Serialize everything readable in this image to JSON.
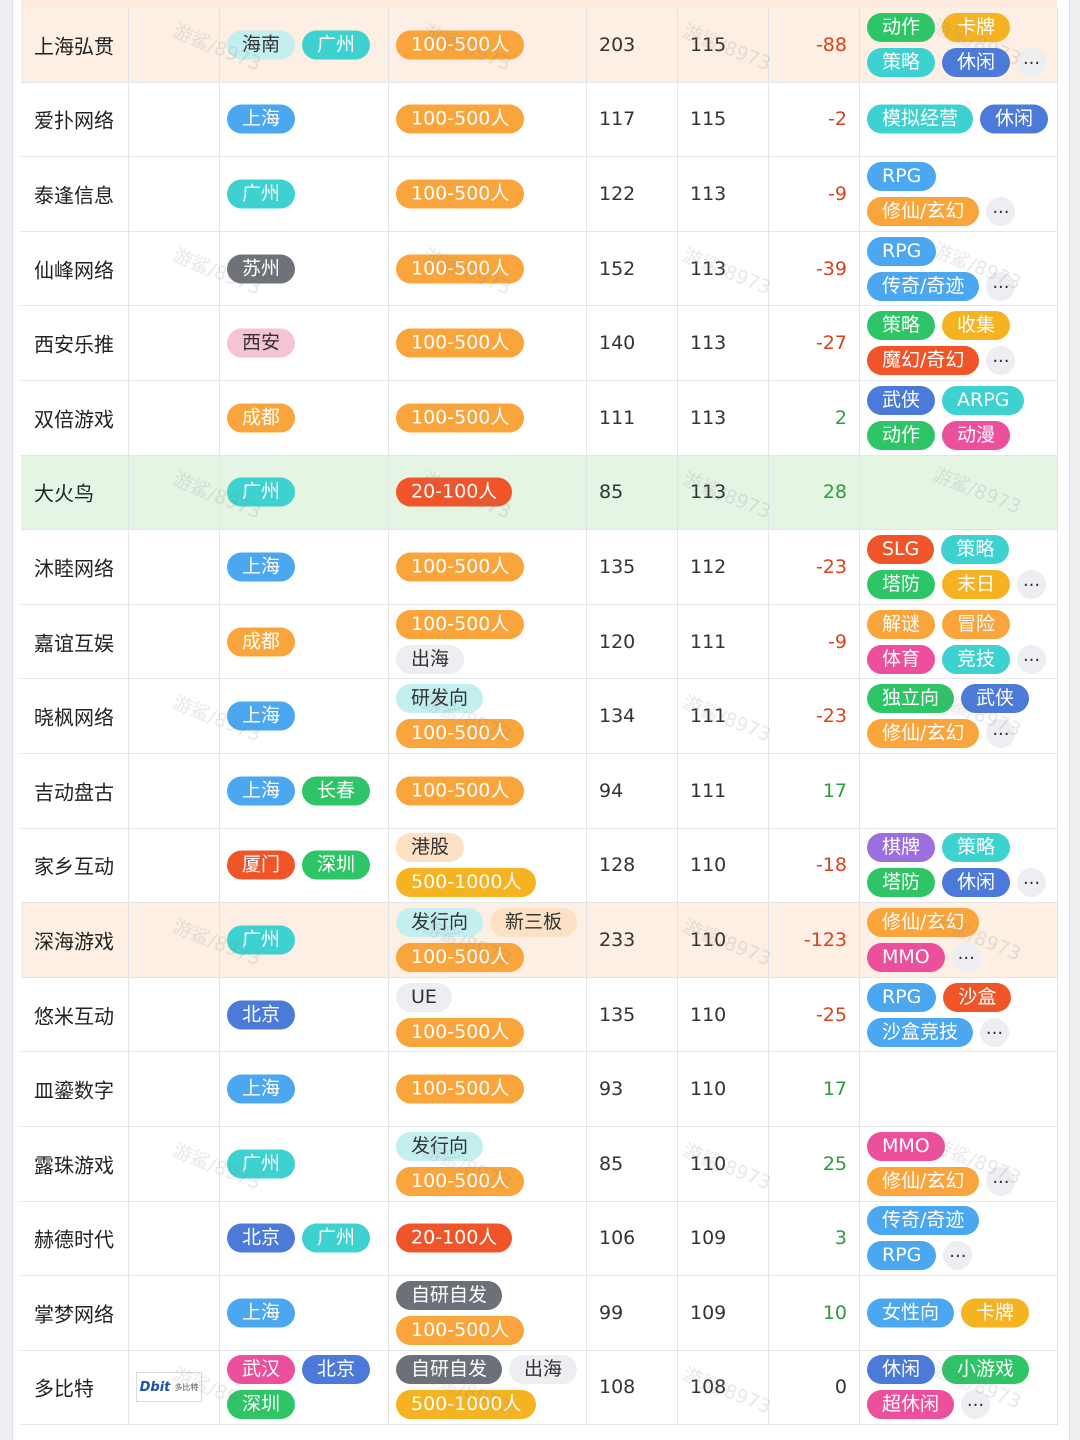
{
  "palette": {
    "cyan": "#3dd2cf",
    "lightcyan": "#c4eff0",
    "blue": "#4aa7f0",
    "gray": "#6e737a",
    "pink": "#f6c3d2",
    "orange": "#f9a53b",
    "red": "#f0552a",
    "green": "#2ec566",
    "peach": "#fde1c4",
    "lightgray": "#eceef1",
    "purple": "#9b6fdd",
    "steel": "#4b7ad8",
    "yellow": "#f6b321",
    "magenta": "#ec4f9b",
    "darkgray": "#6b7079"
  },
  "watermark": "游鲨/8973",
  "more_label": "...",
  "rows": [
    {
      "name": "上海弘贯",
      "style": "orange",
      "logo": null,
      "city": [
        [
          [
            "海南",
            "lightcyan"
          ],
          [
            "广州",
            "cyan"
          ]
        ]
      ],
      "tags": [
        [
          [
            "100-500人",
            "orange"
          ]
        ]
      ],
      "a": "203",
      "b": "115",
      "d": "-88",
      "dtype": "neg",
      "games": [
        [
          [
            "动作",
            "green"
          ],
          [
            "卡牌",
            "yellow"
          ]
        ],
        [
          [
            "策略",
            "cyan"
          ],
          [
            "休闲",
            "steel"
          ],
          [
            "...",
            "more"
          ]
        ]
      ]
    },
    {
      "name": "爱扑网络",
      "style": "",
      "logo": null,
      "city": [
        [
          [
            "上海",
            "blue"
          ]
        ]
      ],
      "tags": [
        [
          [
            "100-500人",
            "orange"
          ]
        ]
      ],
      "a": "117",
      "b": "115",
      "d": "-2",
      "dtype": "neg",
      "games": [
        [
          [
            "模拟经营",
            "cyan"
          ],
          [
            "休闲",
            "steel"
          ]
        ]
      ]
    },
    {
      "name": "泰逢信息",
      "style": "",
      "logo": null,
      "city": [
        [
          [
            "广州",
            "cyan"
          ]
        ]
      ],
      "tags": [
        [
          [
            "100-500人",
            "orange"
          ]
        ]
      ],
      "a": "122",
      "b": "113",
      "d": "-9",
      "dtype": "neg",
      "games": [
        [
          [
            "RPG",
            "blue"
          ]
        ],
        [
          [
            "修仙/玄幻",
            "orange"
          ],
          [
            "...",
            "more"
          ]
        ]
      ]
    },
    {
      "name": "仙峰网络",
      "style": "",
      "logo": null,
      "city": [
        [
          [
            "苏州",
            "gray"
          ]
        ]
      ],
      "tags": [
        [
          [
            "100-500人",
            "orange"
          ]
        ]
      ],
      "a": "152",
      "b": "113",
      "d": "-39",
      "dtype": "neg",
      "games": [
        [
          [
            "RPG",
            "blue"
          ]
        ],
        [
          [
            "传奇/奇迹",
            "blue"
          ],
          [
            "...",
            "more"
          ]
        ]
      ]
    },
    {
      "name": "西安乐推",
      "style": "",
      "logo": null,
      "city": [
        [
          [
            "西安",
            "pink"
          ]
        ]
      ],
      "tags": [
        [
          [
            "100-500人",
            "orange"
          ]
        ]
      ],
      "a": "140",
      "b": "113",
      "d": "-27",
      "dtype": "neg",
      "games": [
        [
          [
            "策略",
            "green"
          ],
          [
            "收集",
            "yellow"
          ]
        ],
        [
          [
            "魔幻/奇幻",
            "red"
          ],
          [
            "...",
            "more"
          ]
        ]
      ]
    },
    {
      "name": "双倍游戏",
      "style": "",
      "logo": null,
      "city": [
        [
          [
            "成都",
            "orange"
          ]
        ]
      ],
      "tags": [
        [
          [
            "100-500人",
            "orange"
          ]
        ]
      ],
      "a": "111",
      "b": "113",
      "d": "2",
      "dtype": "pos",
      "games": [
        [
          [
            "武侠",
            "steel"
          ],
          [
            "ARPG",
            "cyan"
          ]
        ],
        [
          [
            "动作",
            "green"
          ],
          [
            "动漫",
            "magenta"
          ]
        ]
      ]
    },
    {
      "name": "大火鸟",
      "style": "green",
      "logo": null,
      "city": [
        [
          [
            "广州",
            "cyan"
          ]
        ]
      ],
      "tags": [
        [
          [
            "20-100人",
            "red"
          ]
        ]
      ],
      "a": "85",
      "b": "113",
      "d": "28",
      "dtype": "pos",
      "games": []
    },
    {
      "name": "沐睦网络",
      "style": "",
      "logo": null,
      "city": [
        [
          [
            "上海",
            "blue"
          ]
        ]
      ],
      "tags": [
        [
          [
            "100-500人",
            "orange"
          ]
        ]
      ],
      "a": "135",
      "b": "112",
      "d": "-23",
      "dtype": "neg",
      "games": [
        [
          [
            "SLG",
            "red"
          ],
          [
            "策略",
            "cyan"
          ]
        ],
        [
          [
            "塔防",
            "green"
          ],
          [
            "末日",
            "yellow"
          ],
          [
            "...",
            "more"
          ]
        ]
      ]
    },
    {
      "name": "嘉谊互娱",
      "style": "",
      "logo": null,
      "city": [
        [
          [
            "成都",
            "orange"
          ]
        ]
      ],
      "tags": [
        [
          [
            "100-500人",
            "orange"
          ]
        ],
        [
          [
            "出海",
            "lightgray"
          ]
        ]
      ],
      "a": "120",
      "b": "111",
      "d": "-9",
      "dtype": "neg",
      "games": [
        [
          [
            "解谜",
            "orange"
          ],
          [
            "冒险",
            "orange"
          ]
        ],
        [
          [
            "体育",
            "magenta"
          ],
          [
            "竞技",
            "cyan"
          ],
          [
            "...",
            "more"
          ]
        ]
      ]
    },
    {
      "name": "晓枫网络",
      "style": "",
      "logo": null,
      "city": [
        [
          [
            "上海",
            "blue"
          ]
        ]
      ],
      "tags": [
        [
          [
            "研发向",
            "lightcyan"
          ]
        ],
        [
          [
            "100-500人",
            "orange"
          ]
        ]
      ],
      "a": "134",
      "b": "111",
      "d": "-23",
      "dtype": "neg",
      "games": [
        [
          [
            "独立向",
            "green"
          ],
          [
            "武侠",
            "steel"
          ]
        ],
        [
          [
            "修仙/玄幻",
            "orange"
          ],
          [
            "...",
            "more"
          ]
        ]
      ]
    },
    {
      "name": "吉动盘古",
      "style": "",
      "logo": null,
      "city": [
        [
          [
            "上海",
            "blue"
          ],
          [
            "长春",
            "green"
          ]
        ]
      ],
      "tags": [
        [
          [
            "100-500人",
            "orange"
          ]
        ]
      ],
      "a": "94",
      "b": "111",
      "d": "17",
      "dtype": "pos",
      "games": []
    },
    {
      "name": "家乡互动",
      "style": "",
      "logo": null,
      "city": [
        [
          [
            "厦门",
            "red"
          ],
          [
            "深圳",
            "green"
          ]
        ]
      ],
      "tags": [
        [
          [
            "港股",
            "peach"
          ]
        ],
        [
          [
            "500-1000人",
            "yellow"
          ]
        ]
      ],
      "a": "128",
      "b": "110",
      "d": "-18",
      "dtype": "neg",
      "games": [
        [
          [
            "棋牌",
            "purple"
          ],
          [
            "策略",
            "cyan"
          ]
        ],
        [
          [
            "塔防",
            "green"
          ],
          [
            "休闲",
            "steel"
          ],
          [
            "...",
            "more"
          ]
        ]
      ]
    },
    {
      "name": "深海游戏",
      "style": "orange",
      "logo": null,
      "city": [
        [
          [
            "广州",
            "cyan"
          ]
        ]
      ],
      "tags": [
        [
          [
            "发行向",
            "lightcyan"
          ],
          [
            "新三板",
            "peach"
          ]
        ],
        [
          [
            "100-500人",
            "orange"
          ]
        ]
      ],
      "a": "233",
      "b": "110",
      "d": "-123",
      "dtype": "neg",
      "games": [
        [
          [
            "修仙/玄幻",
            "orange"
          ]
        ],
        [
          [
            "MMO",
            "magenta"
          ],
          [
            "...",
            "more"
          ]
        ]
      ]
    },
    {
      "name": "悠米互动",
      "style": "",
      "logo": null,
      "city": [
        [
          [
            "北京",
            "steel"
          ]
        ]
      ],
      "tags": [
        [
          [
            "UE",
            "lightgray"
          ]
        ],
        [
          [
            "100-500人",
            "orange"
          ]
        ]
      ],
      "a": "135",
      "b": "110",
      "d": "-25",
      "dtype": "neg",
      "games": [
        [
          [
            "RPG",
            "blue"
          ],
          [
            "沙盒",
            "red"
          ]
        ],
        [
          [
            "沙盒竞技",
            "blue"
          ],
          [
            "...",
            "more"
          ]
        ]
      ]
    },
    {
      "name": "皿鎏数字",
      "style": "",
      "logo": null,
      "city": [
        [
          [
            "上海",
            "blue"
          ]
        ]
      ],
      "tags": [
        [
          [
            "100-500人",
            "orange"
          ]
        ]
      ],
      "a": "93",
      "b": "110",
      "d": "17",
      "dtype": "pos",
      "games": []
    },
    {
      "name": "露珠游戏",
      "style": "",
      "logo": null,
      "city": [
        [
          [
            "广州",
            "cyan"
          ]
        ]
      ],
      "tags": [
        [
          [
            "发行向",
            "lightcyan"
          ]
        ],
        [
          [
            "100-500人",
            "orange"
          ]
        ]
      ],
      "a": "85",
      "b": "110",
      "d": "25",
      "dtype": "pos",
      "games": [
        [
          [
            "MMO",
            "magenta"
          ]
        ],
        [
          [
            "修仙/玄幻",
            "orange"
          ],
          [
            "...",
            "more"
          ]
        ]
      ]
    },
    {
      "name": "赫德时代",
      "style": "",
      "logo": null,
      "city": [
        [
          [
            "北京",
            "steel"
          ],
          [
            "广州",
            "cyan"
          ]
        ]
      ],
      "tags": [
        [
          [
            "20-100人",
            "red"
          ]
        ]
      ],
      "a": "106",
      "b": "109",
      "d": "3",
      "dtype": "pos",
      "games": [
        [
          [
            "传奇/奇迹",
            "blue"
          ]
        ],
        [
          [
            "RPG",
            "blue"
          ],
          [
            "...",
            "more"
          ]
        ]
      ]
    },
    {
      "name": "掌梦网络",
      "style": "",
      "logo": null,
      "city": [
        [
          [
            "上海",
            "blue"
          ]
        ]
      ],
      "tags": [
        [
          [
            "自研自发",
            "darkgray"
          ]
        ],
        [
          [
            "100-500人",
            "orange"
          ]
        ]
      ],
      "a": "99",
      "b": "109",
      "d": "10",
      "dtype": "pos",
      "games": [
        [
          [
            "女性向",
            "blue"
          ],
          [
            "卡牌",
            "yellow"
          ]
        ]
      ]
    },
    {
      "name": "多比特",
      "style": "",
      "logo": {
        "mark": "Dbit",
        "text": "多比特"
      },
      "city": [
        [
          [
            "武汉",
            "magenta"
          ],
          [
            "北京",
            "steel"
          ]
        ],
        [
          [
            "深圳",
            "green"
          ]
        ]
      ],
      "tags": [
        [
          [
            "自研自发",
            "darkgray"
          ],
          [
            "出海",
            "lightgray"
          ]
        ],
        [
          [
            "500-1000人",
            "yellow"
          ]
        ]
      ],
      "a": "108",
      "b": "108",
      "d": "0",
      "dtype": "zero",
      "games": [
        [
          [
            "休闲",
            "steel"
          ],
          [
            "小游戏",
            "green"
          ]
        ],
        [
          [
            "超休闲",
            "magenta"
          ],
          [
            "...",
            "more"
          ]
        ]
      ]
    }
  ]
}
